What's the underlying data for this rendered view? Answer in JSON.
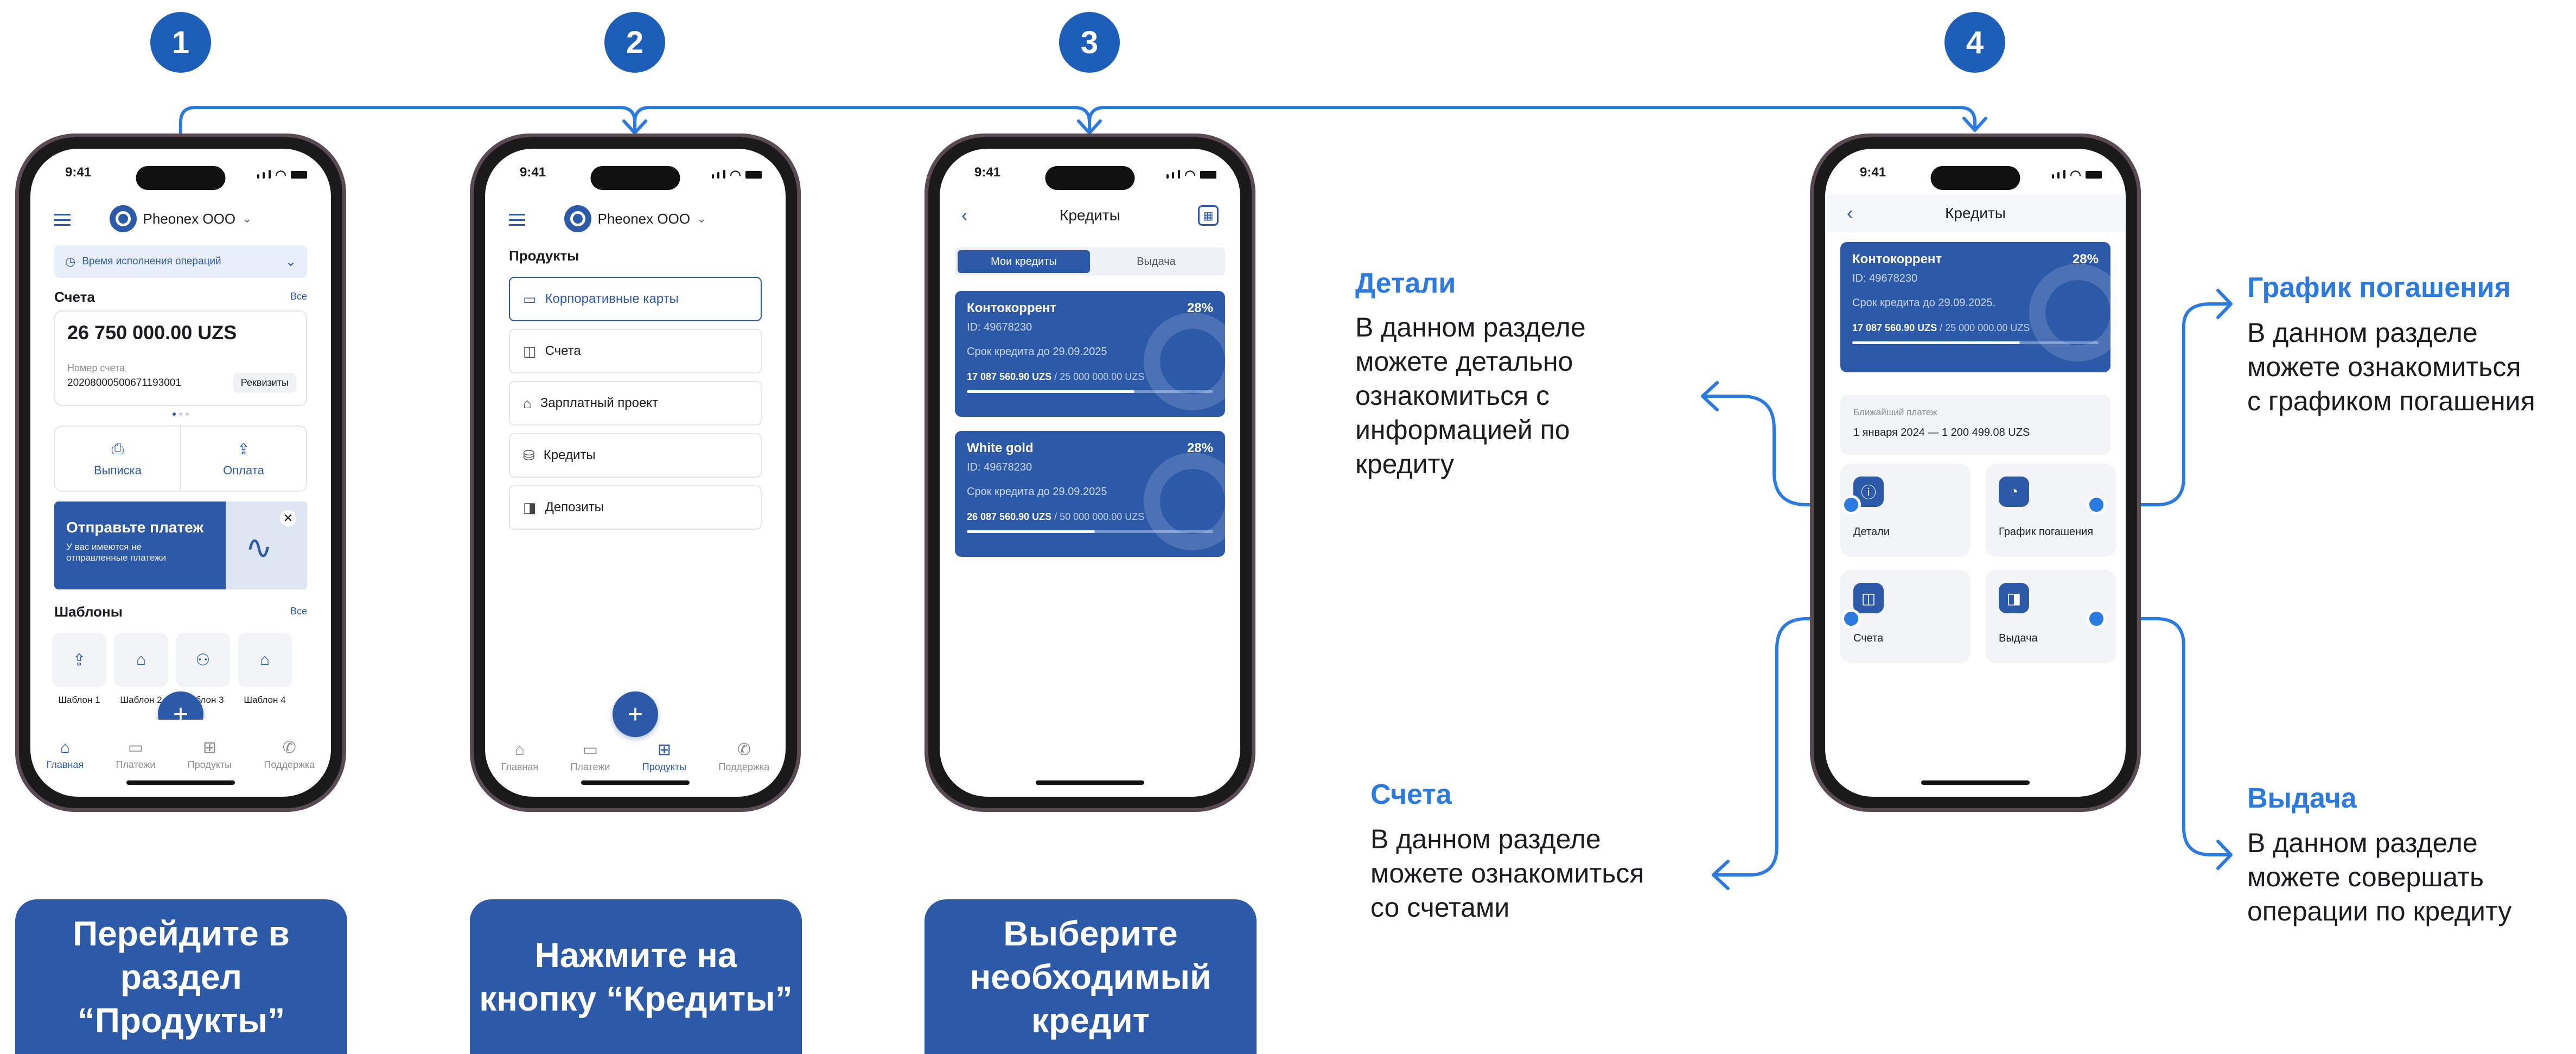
{
  "steps": [
    {
      "number": "1",
      "caption": "Перейдите в\nраздел\n“Продукты”"
    },
    {
      "number": "2",
      "caption": "Нажмите на\nкнопку “Кредиты”"
    },
    {
      "number": "3",
      "caption": "Выберите\nнеобходимый\nкредит"
    },
    {
      "number": "4"
    }
  ],
  "colors": {
    "primary": "#2d5aa8",
    "badge": "#1d5fb8",
    "accent": "#2b7ae0",
    "frame": "#5a4a52"
  },
  "status_time": "9:41",
  "phone1": {
    "org": "Pheonex OOO",
    "ops_banner": "Время исполнения операций",
    "accounts_title": "Счета",
    "accounts_all": "Все",
    "balance": "26 750 000.00 UZS",
    "account_label": "Номер счета",
    "account_number": "20208000500671193001",
    "requisites": "Реквизиты",
    "actions": [
      {
        "label": "Выписка",
        "icon": "document-download-icon"
      },
      {
        "label": "Оплата",
        "icon": "upload-icon"
      }
    ],
    "promo_title": "Отправьте платеж",
    "promo_text": "У вас имеются не\nотправленные платежи",
    "templates_title": "Шаблоны",
    "templates_all": "Все",
    "templates": [
      "Шаблон 1",
      "Шаблон 2",
      "Шаблон 3",
      "Шаблон 4"
    ]
  },
  "tabbar": [
    {
      "label": "Главная",
      "icon": "home-icon"
    },
    {
      "label": "Платежи",
      "icon": "wallet-icon"
    },
    {
      "label": "Продукты",
      "icon": "grid-icon"
    },
    {
      "label": "Поддержка",
      "icon": "phone-icon"
    }
  ],
  "phone2": {
    "org": "Pheonex OOO",
    "section_title": "Продукты",
    "products": [
      "Корпоративные карты",
      "Счета",
      "Зарплатный проект",
      "Кредиты",
      "Депозиты"
    ]
  },
  "phone3": {
    "title": "Кредиты",
    "tabs": [
      "Мои кредиты",
      "Выдача"
    ],
    "credits": [
      {
        "name": "Контокоррент",
        "rate": "28%",
        "id": "ID: 49678230",
        "term": "Срок кредита до 29.09.2025",
        "paid": "17 087 560.90 UZS",
        "total": "/ 25 000 000.00 UZS",
        "progress": 0.68
      },
      {
        "name": "White gold",
        "rate": "28%",
        "id": "ID: 49678230",
        "term": "Срок кредита до 29.09.2025",
        "paid": "26 087 560.90 UZS",
        "total": "/ 50 000 000.00 UZS",
        "progress": 0.52
      }
    ]
  },
  "phone4": {
    "title": "Кредиты",
    "credit": {
      "name": "Контокоррент",
      "rate": "28%",
      "id": "ID: 49678230",
      "term": "Срок кредита до 29.09.2025.",
      "paid": "17 087 560.90 UZS",
      "total": "/ 25 000 000.00 UZS",
      "progress": 0.68
    },
    "next_label": "Ближайший платеж",
    "next_value": "1 января 2024 — 1 200 499.08 UZS",
    "tiles": [
      {
        "label": "Детали",
        "icon": "info-icon"
      },
      {
        "label": "График погашения",
        "icon": "schedule-icon"
      },
      {
        "label": "Счета",
        "icon": "wallet-icon"
      },
      {
        "label": "Выдача",
        "icon": "cash-icon"
      }
    ]
  },
  "annotations": {
    "details": {
      "title": "Детали",
      "text": "В данном разделе\nможете детально\nознакомиться с\nинформацией по\nкредиту"
    },
    "schedule": {
      "title": "График погашения",
      "text": "В данном разделе\nможете ознакомиться\nс графиком погашения"
    },
    "accounts": {
      "title": "Счета",
      "text": "В данном разделе\nможете ознакомиться\nсо счетами"
    },
    "issuance": {
      "title": "Выдача",
      "text": "В данном разделе\nможете совершать\nоперации по кредиту"
    }
  }
}
